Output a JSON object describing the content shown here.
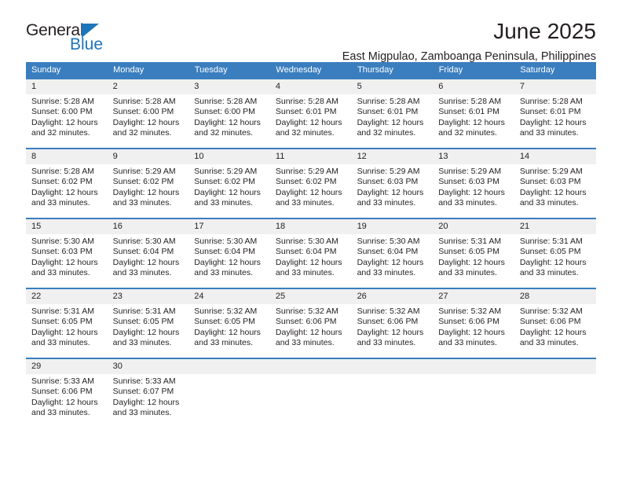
{
  "brand": {
    "name_top": "General",
    "name_bottom": "Blue",
    "triangle_color": "#1b75bb"
  },
  "header": {
    "title": "June 2025",
    "subtitle": "East Migpulao, Zamboanga Peninsula, Philippines"
  },
  "theme": {
    "header_bg": "#3a7ebf",
    "daynum_bg": "#f0f0f0",
    "text": "#231f20"
  },
  "weekdays": [
    "Sunday",
    "Monday",
    "Tuesday",
    "Wednesday",
    "Thursday",
    "Friday",
    "Saturday"
  ],
  "weeks": [
    [
      {
        "day": "1",
        "sunrise": "Sunrise: 5:28 AM",
        "sunset": "Sunset: 6:00 PM",
        "daylight_line1": "Daylight: 12 hours",
        "daylight_line2": "and 32 minutes."
      },
      {
        "day": "2",
        "sunrise": "Sunrise: 5:28 AM",
        "sunset": "Sunset: 6:00 PM",
        "daylight_line1": "Daylight: 12 hours",
        "daylight_line2": "and 32 minutes."
      },
      {
        "day": "3",
        "sunrise": "Sunrise: 5:28 AM",
        "sunset": "Sunset: 6:00 PM",
        "daylight_line1": "Daylight: 12 hours",
        "daylight_line2": "and 32 minutes."
      },
      {
        "day": "4",
        "sunrise": "Sunrise: 5:28 AM",
        "sunset": "Sunset: 6:01 PM",
        "daylight_line1": "Daylight: 12 hours",
        "daylight_line2": "and 32 minutes."
      },
      {
        "day": "5",
        "sunrise": "Sunrise: 5:28 AM",
        "sunset": "Sunset: 6:01 PM",
        "daylight_line1": "Daylight: 12 hours",
        "daylight_line2": "and 32 minutes."
      },
      {
        "day": "6",
        "sunrise": "Sunrise: 5:28 AM",
        "sunset": "Sunset: 6:01 PM",
        "daylight_line1": "Daylight: 12 hours",
        "daylight_line2": "and 32 minutes."
      },
      {
        "day": "7",
        "sunrise": "Sunrise: 5:28 AM",
        "sunset": "Sunset: 6:01 PM",
        "daylight_line1": "Daylight: 12 hours",
        "daylight_line2": "and 33 minutes."
      }
    ],
    [
      {
        "day": "8",
        "sunrise": "Sunrise: 5:28 AM",
        "sunset": "Sunset: 6:02 PM",
        "daylight_line1": "Daylight: 12 hours",
        "daylight_line2": "and 33 minutes."
      },
      {
        "day": "9",
        "sunrise": "Sunrise: 5:29 AM",
        "sunset": "Sunset: 6:02 PM",
        "daylight_line1": "Daylight: 12 hours",
        "daylight_line2": "and 33 minutes."
      },
      {
        "day": "10",
        "sunrise": "Sunrise: 5:29 AM",
        "sunset": "Sunset: 6:02 PM",
        "daylight_line1": "Daylight: 12 hours",
        "daylight_line2": "and 33 minutes."
      },
      {
        "day": "11",
        "sunrise": "Sunrise: 5:29 AM",
        "sunset": "Sunset: 6:02 PM",
        "daylight_line1": "Daylight: 12 hours",
        "daylight_line2": "and 33 minutes."
      },
      {
        "day": "12",
        "sunrise": "Sunrise: 5:29 AM",
        "sunset": "Sunset: 6:03 PM",
        "daylight_line1": "Daylight: 12 hours",
        "daylight_line2": "and 33 minutes."
      },
      {
        "day": "13",
        "sunrise": "Sunrise: 5:29 AM",
        "sunset": "Sunset: 6:03 PM",
        "daylight_line1": "Daylight: 12 hours",
        "daylight_line2": "and 33 minutes."
      },
      {
        "day": "14",
        "sunrise": "Sunrise: 5:29 AM",
        "sunset": "Sunset: 6:03 PM",
        "daylight_line1": "Daylight: 12 hours",
        "daylight_line2": "and 33 minutes."
      }
    ],
    [
      {
        "day": "15",
        "sunrise": "Sunrise: 5:30 AM",
        "sunset": "Sunset: 6:03 PM",
        "daylight_line1": "Daylight: 12 hours",
        "daylight_line2": "and 33 minutes."
      },
      {
        "day": "16",
        "sunrise": "Sunrise: 5:30 AM",
        "sunset": "Sunset: 6:04 PM",
        "daylight_line1": "Daylight: 12 hours",
        "daylight_line2": "and 33 minutes."
      },
      {
        "day": "17",
        "sunrise": "Sunrise: 5:30 AM",
        "sunset": "Sunset: 6:04 PM",
        "daylight_line1": "Daylight: 12 hours",
        "daylight_line2": "and 33 minutes."
      },
      {
        "day": "18",
        "sunrise": "Sunrise: 5:30 AM",
        "sunset": "Sunset: 6:04 PM",
        "daylight_line1": "Daylight: 12 hours",
        "daylight_line2": "and 33 minutes."
      },
      {
        "day": "19",
        "sunrise": "Sunrise: 5:30 AM",
        "sunset": "Sunset: 6:04 PM",
        "daylight_line1": "Daylight: 12 hours",
        "daylight_line2": "and 33 minutes."
      },
      {
        "day": "20",
        "sunrise": "Sunrise: 5:31 AM",
        "sunset": "Sunset: 6:05 PM",
        "daylight_line1": "Daylight: 12 hours",
        "daylight_line2": "and 33 minutes."
      },
      {
        "day": "21",
        "sunrise": "Sunrise: 5:31 AM",
        "sunset": "Sunset: 6:05 PM",
        "daylight_line1": "Daylight: 12 hours",
        "daylight_line2": "and 33 minutes."
      }
    ],
    [
      {
        "day": "22",
        "sunrise": "Sunrise: 5:31 AM",
        "sunset": "Sunset: 6:05 PM",
        "daylight_line1": "Daylight: 12 hours",
        "daylight_line2": "and 33 minutes."
      },
      {
        "day": "23",
        "sunrise": "Sunrise: 5:31 AM",
        "sunset": "Sunset: 6:05 PM",
        "daylight_line1": "Daylight: 12 hours",
        "daylight_line2": "and 33 minutes."
      },
      {
        "day": "24",
        "sunrise": "Sunrise: 5:32 AM",
        "sunset": "Sunset: 6:05 PM",
        "daylight_line1": "Daylight: 12 hours",
        "daylight_line2": "and 33 minutes."
      },
      {
        "day": "25",
        "sunrise": "Sunrise: 5:32 AM",
        "sunset": "Sunset: 6:06 PM",
        "daylight_line1": "Daylight: 12 hours",
        "daylight_line2": "and 33 minutes."
      },
      {
        "day": "26",
        "sunrise": "Sunrise: 5:32 AM",
        "sunset": "Sunset: 6:06 PM",
        "daylight_line1": "Daylight: 12 hours",
        "daylight_line2": "and 33 minutes."
      },
      {
        "day": "27",
        "sunrise": "Sunrise: 5:32 AM",
        "sunset": "Sunset: 6:06 PM",
        "daylight_line1": "Daylight: 12 hours",
        "daylight_line2": "and 33 minutes."
      },
      {
        "day": "28",
        "sunrise": "Sunrise: 5:32 AM",
        "sunset": "Sunset: 6:06 PM",
        "daylight_line1": "Daylight: 12 hours",
        "daylight_line2": "and 33 minutes."
      }
    ],
    [
      {
        "day": "29",
        "sunrise": "Sunrise: 5:33 AM",
        "sunset": "Sunset: 6:06 PM",
        "daylight_line1": "Daylight: 12 hours",
        "daylight_line2": "and 33 minutes."
      },
      {
        "day": "30",
        "sunrise": "Sunrise: 5:33 AM",
        "sunset": "Sunset: 6:07 PM",
        "daylight_line1": "Daylight: 12 hours",
        "daylight_line2": "and 33 minutes."
      },
      {
        "day": "",
        "sunrise": "",
        "sunset": "",
        "daylight_line1": "",
        "daylight_line2": ""
      },
      {
        "day": "",
        "sunrise": "",
        "sunset": "",
        "daylight_line1": "",
        "daylight_line2": ""
      },
      {
        "day": "",
        "sunrise": "",
        "sunset": "",
        "daylight_line1": "",
        "daylight_line2": ""
      },
      {
        "day": "",
        "sunrise": "",
        "sunset": "",
        "daylight_line1": "",
        "daylight_line2": ""
      },
      {
        "day": "",
        "sunrise": "",
        "sunset": "",
        "daylight_line1": "",
        "daylight_line2": ""
      }
    ]
  ]
}
